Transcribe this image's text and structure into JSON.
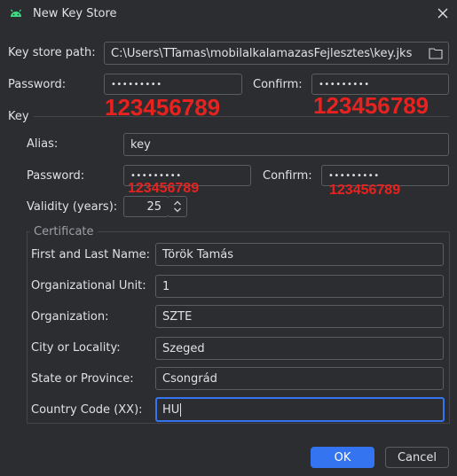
{
  "window": {
    "title": "New Key Store"
  },
  "keystore": {
    "path_label": "Key store path:",
    "path_value": "C:\\Users\\TTamas\\mobilalkalamazasFejlesztes\\key.jks",
    "password_label": "Password:",
    "password_value": "•••••••••",
    "password_annotation": "123456789",
    "confirm_label": "Confirm:",
    "confirm_value": "•••••••••",
    "confirm_annotation": "123456789"
  },
  "key": {
    "section_label": "Key",
    "alias_label": "Alias:",
    "alias_value": "key",
    "password_label": "Password:",
    "password_value": "•••••••••",
    "password_annotation": "123456789",
    "confirm_label": "Confirm:",
    "confirm_value": "•••••••••",
    "confirm_annotation": "123456789",
    "validity_label": "Validity (years):",
    "validity_value": "25"
  },
  "certificate": {
    "group_label": "Certificate",
    "first_last_label": "First and Last Name:",
    "first_last_value": "Török Tamás",
    "org_unit_label": "Organizational Unit:",
    "org_unit_value": "1",
    "organization_label": "Organization:",
    "organization_value": "SZTE",
    "city_label": "City or Locality:",
    "city_value": "Szeged",
    "state_label": "State or Province:",
    "state_value": "Csongrád",
    "country_label": "Country Code (XX):",
    "country_value": "HU"
  },
  "buttons": {
    "ok": "OK",
    "cancel": "Cancel"
  },
  "colors": {
    "accent": "#3574f0",
    "annotation": "#e8221f",
    "background": "#2b2d30"
  },
  "icons": {
    "app": "android-icon",
    "close": "close-icon",
    "folder": "folder-icon",
    "spinner": "spinner-arrows-icon"
  }
}
